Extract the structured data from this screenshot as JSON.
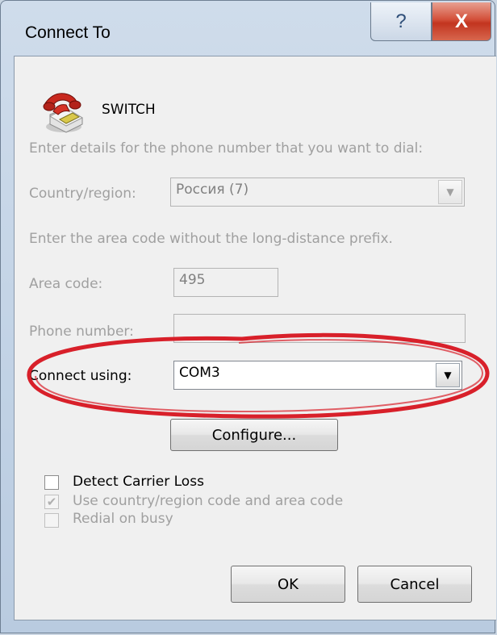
{
  "window": {
    "title": "Connect To",
    "help_glyph": "?",
    "close_glyph": "X"
  },
  "connection": {
    "name": "SWITCH",
    "icon": "phone-icon"
  },
  "form": {
    "instructions": "Enter details for the phone number that you want to dial:",
    "country_label": "Country/region:",
    "country_value": "Россия (7)",
    "area_hint": "Enter the area code without the long-distance prefix.",
    "area_label": "Area code:",
    "area_value": "495",
    "phone_label": "Phone number:",
    "phone_value": "",
    "connect_label": "Connect using:",
    "connect_value": "COM3",
    "configure_label": "Configure..."
  },
  "options": {
    "detect_carrier": {
      "label": "Detect Carrier Loss",
      "checked": false
    },
    "use_country_code": {
      "label": "Use country/region code and area code",
      "checked": true
    },
    "redial": {
      "label": "Redial on busy",
      "checked": false
    }
  },
  "footer": {
    "ok_label": "OK",
    "cancel_label": "Cancel"
  },
  "colors": {
    "annotation": "#d8202a",
    "close_button": "#c9412a"
  }
}
